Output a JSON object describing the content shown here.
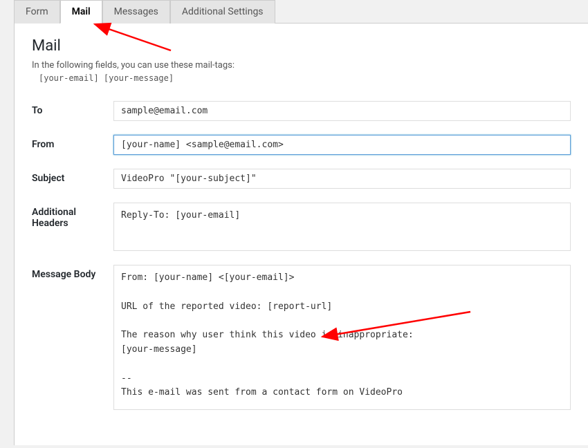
{
  "tabs": {
    "form": "Form",
    "mail": "Mail",
    "messages": "Messages",
    "additional_settings": "Additional Settings"
  },
  "section": {
    "title": "Mail",
    "desc": "In the following fields, you can use these mail-tags:",
    "mail_tags": "[your-email] [your-message]"
  },
  "fields": {
    "to": {
      "label": "To",
      "value": "sample@email.com"
    },
    "from": {
      "label": "From",
      "value": "[your-name] <sample@email.com>"
    },
    "subject": {
      "label": "Subject",
      "value": "VideoPro \"[your-subject]\""
    },
    "headers": {
      "label": "Additional Headers",
      "value": "Reply-To: [your-email]"
    },
    "body": {
      "label": "Message Body",
      "value": "From: [your-name] <[your-email]>\n\nURL of the reported video: [report-url]\n\nThe reason why user think this video is inappropriate:\n[your-message]\n\n--\nThis e-mail was sent from a contact form on VideoPro"
    }
  }
}
